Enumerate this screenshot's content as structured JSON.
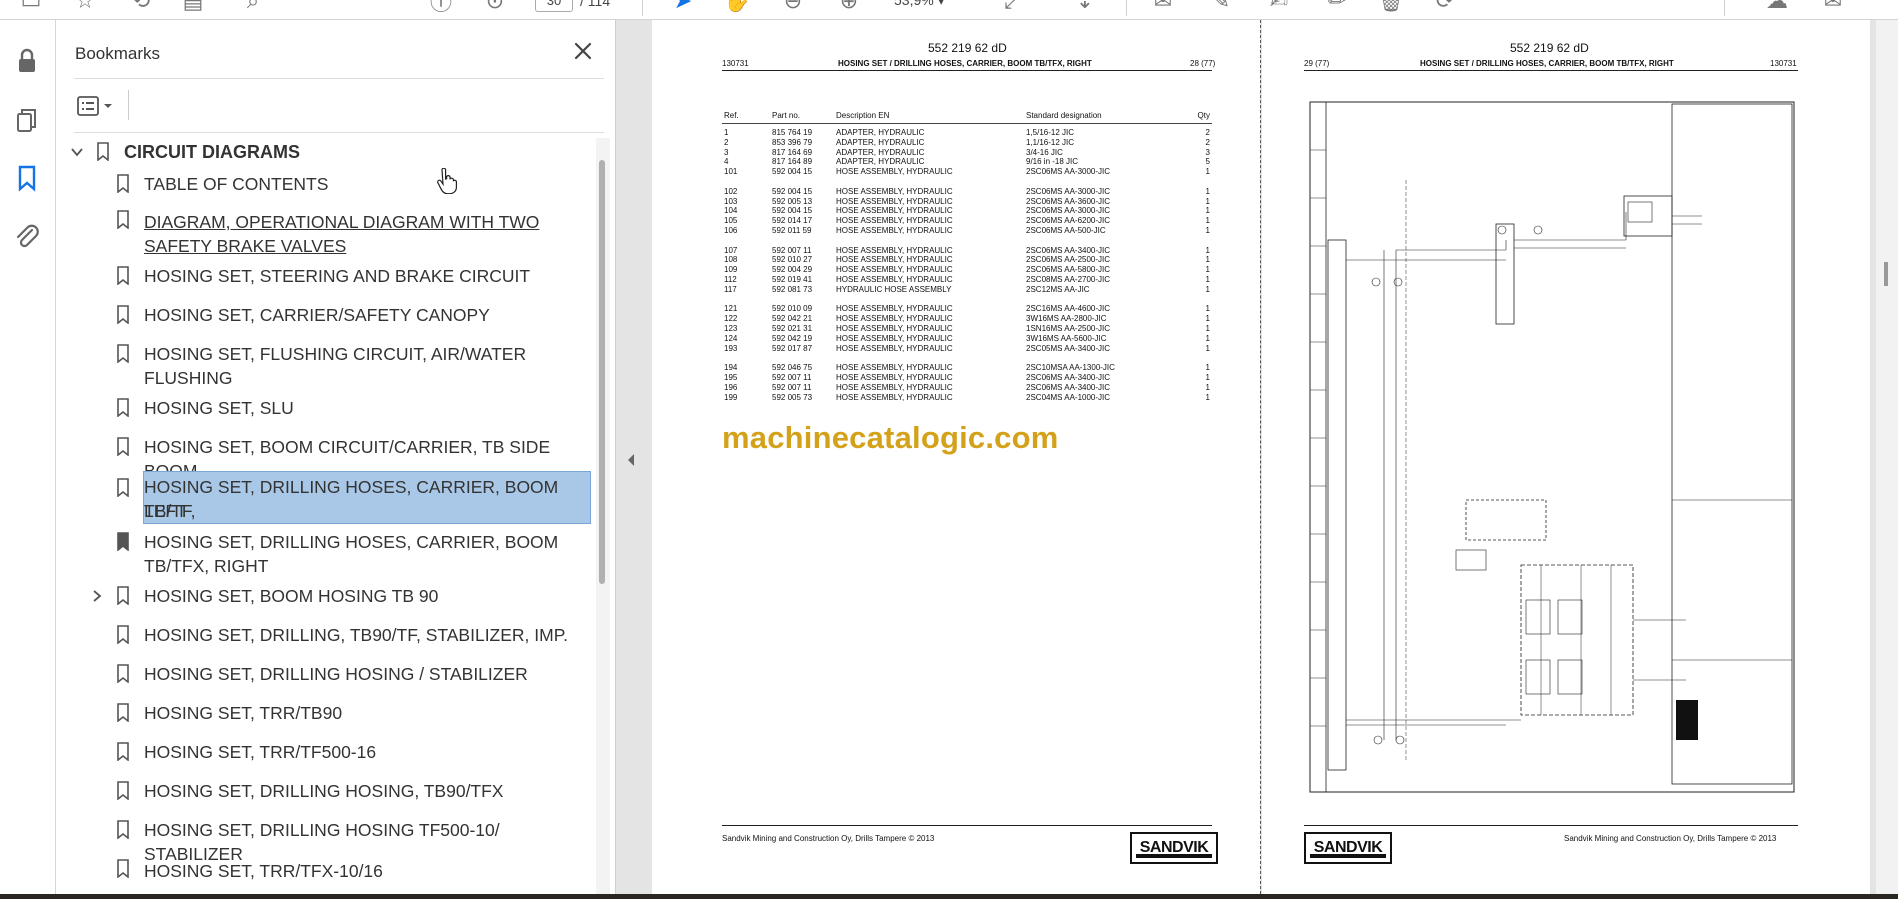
{
  "toolbar": {
    "page_current": "30",
    "page_total": "/ 114",
    "zoom": "53,9%"
  },
  "bookmarks": {
    "title": "Bookmarks",
    "root_label": "CIRCUIT DIAGRAMS",
    "items": [
      {
        "label": "TABLE OF CONTENTS"
      },
      {
        "label": "DIAGRAM, OPERATIONAL DIAGRAM WITH TWO"
      },
      {
        "label": "SAFETY BRAKE VALVES"
      },
      {
        "label": "HOSING SET, STEERING AND BRAKE CIRCUIT"
      },
      {
        "label": "HOSING SET, CARRIER/SAFETY CANOPY"
      },
      {
        "label": "HOSING SET, FLUSHING CIRCUIT, AIR/WATER"
      },
      {
        "label": "FLUSHING"
      },
      {
        "label": "HOSING SET, SLU"
      },
      {
        "label": "HOSING SET, BOOM CIRCUIT/CARRIER, TB SIDE BOOM"
      },
      {
        "label": "HOSING SET, DRILLING HOSES, CARRIER, BOOM TB/TF,"
      },
      {
        "label": "LEFT"
      },
      {
        "label": "HOSING SET, DRILLING HOSES, CARRIER,  BOOM"
      },
      {
        "label": "TB/TFX, RIGHT"
      },
      {
        "label": "HOSING SET, BOOM HOSING TB 90"
      },
      {
        "label": "HOSING SET, DRILLING, TB90/TF, STABILIZER, IMP."
      },
      {
        "label": "HOSING SET, DRILLING HOSING / STABILIZER"
      },
      {
        "label": "HOSING SET, TRR/TB90"
      },
      {
        "label": "HOSING SET, TRR/TF500-16"
      },
      {
        "label": "HOSING SET, DRILLING HOSING, TB90/TFX"
      },
      {
        "label": "HOSING SET, DRILLING HOSING TF500-10/ STABILIZER"
      },
      {
        "label": "HOSING SET, TRR/TFX-10/16"
      }
    ]
  },
  "page_left": {
    "doc_number": "552 219 62 dD",
    "code": "130731",
    "title": "HOSING SET / DRILLING HOSES, CARRIER, BOOM TB/TFX, RIGHT",
    "page_label": "28 (77)",
    "columns": {
      "ref": "Ref.",
      "part": "Part no.",
      "desc": "Description EN",
      "std": "Standard designation",
      "qty": "Qty"
    },
    "rows": [
      {
        "ref": "1",
        "part": "815 764 19",
        "desc": "ADAPTER, HYDRAULIC",
        "std": "1,5/16-12 JIC",
        "qty": "2"
      },
      {
        "ref": "2",
        "part": "853 396 79",
        "desc": "ADAPTER, HYDRAULIC",
        "std": "1,1/16-12 JIC",
        "qty": "2"
      },
      {
        "ref": "3",
        "part": "817 164 69",
        "desc": "ADAPTER, HYDRAULIC",
        "std": "3/4-16 JIC",
        "qty": "3"
      },
      {
        "ref": "4",
        "part": "817 164 89",
        "desc": "ADAPTER, HYDRAULIC",
        "std": "9/16 in -18 JIC",
        "qty": "5"
      },
      {
        "ref": "101",
        "part": "592 004 15",
        "desc": "HOSE ASSEMBLY, HYDRAULIC",
        "std": "2SC06MS AA-3000-JIC",
        "qty": "1"
      },
      {
        "ref": "102",
        "part": "592 004 15",
        "desc": "HOSE ASSEMBLY, HYDRAULIC",
        "std": "2SC06MS AA-3000-JIC",
        "qty": "1"
      },
      {
        "ref": "103",
        "part": "592 005 13",
        "desc": "HOSE ASSEMBLY, HYDRAULIC",
        "std": "2SC06MS AA-3600-JIC",
        "qty": "1"
      },
      {
        "ref": "104",
        "part": "592 004 15",
        "desc": "HOSE ASSEMBLY, HYDRAULIC",
        "std": "2SC06MS AA-3000-JIC",
        "qty": "1"
      },
      {
        "ref": "105",
        "part": "592 014 17",
        "desc": "HOSE ASSEMBLY, HYDRAULIC",
        "std": "2SC06MS AA-6200-JIC",
        "qty": "1"
      },
      {
        "ref": "106",
        "part": "592 011 59",
        "desc": "HOSE ASSEMBLY, HYDRAULIC",
        "std": "2SC06MS AA-500-JIC",
        "qty": "1"
      },
      {
        "ref": "107",
        "part": "592 007 11",
        "desc": "HOSE ASSEMBLY, HYDRAULIC",
        "std": "2SC06MS AA-3400-JIC",
        "qty": "1"
      },
      {
        "ref": "108",
        "part": "592 010 27",
        "desc": "HOSE ASSEMBLY, HYDRAULIC",
        "std": "2SC06MS AA-2500-JIC",
        "qty": "1"
      },
      {
        "ref": "109",
        "part": "592 004 29",
        "desc": "HOSE ASSEMBLY, HYDRAULIC",
        "std": "2SC06MS AA-5800-JIC",
        "qty": "1"
      },
      {
        "ref": "112",
        "part": "592 019 41",
        "desc": "HOSE ASSEMBLY, HYDRAULIC",
        "std": "2SC08MS AA-2700-JIC",
        "qty": "1"
      },
      {
        "ref": "117",
        "part": "592 081 73",
        "desc": "HYDRAULIC HOSE ASSEMBLY",
        "std": "2SC12MS AA-JIC",
        "qty": "1"
      },
      {
        "ref": "121",
        "part": "592 010 09",
        "desc": "HOSE ASSEMBLY, HYDRAULIC",
        "std": "2SC16MS AA-4600-JIC",
        "qty": "1"
      },
      {
        "ref": "122",
        "part": "592 042 21",
        "desc": "HOSE ASSEMBLY, HYDRAULIC",
        "std": "3W16MS AA-2800-JIC",
        "qty": "1"
      },
      {
        "ref": "123",
        "part": "592 021 31",
        "desc": "HOSE ASSEMBLY, HYDRAULIC",
        "std": "1SN16MS AA-2500-JIC",
        "qty": "1"
      },
      {
        "ref": "124",
        "part": "592 042 19",
        "desc": "HOSE ASSEMBLY, HYDRAULIC",
        "std": "3W16MS AA-5600-JIC",
        "qty": "1"
      },
      {
        "ref": "193",
        "part": "592 017 87",
        "desc": "HOSE ASSEMBLY, HYDRAULIC",
        "std": "2SC05MS AA-3400-JIC",
        "qty": "1"
      },
      {
        "ref": "194",
        "part": "592 046 75",
        "desc": "HOSE ASSEMBLY, HYDRAULIC",
        "std": "2SC10MSA AA-1300-JIC",
        "qty": "1"
      },
      {
        "ref": "195",
        "part": "592 007 11",
        "desc": "HOSE ASSEMBLY, HYDRAULIC",
        "std": "2SC06MS AA-3400-JIC",
        "qty": "1"
      },
      {
        "ref": "196",
        "part": "592 007 11",
        "desc": "HOSE ASSEMBLY, HYDRAULIC",
        "std": "2SC06MS AA-3400-JIC",
        "qty": "1"
      },
      {
        "ref": "199",
        "part": "592 005 73",
        "desc": "HOSE ASSEMBLY, HYDRAULIC",
        "std": "2SC04MS AA-1000-JIC",
        "qty": "1"
      }
    ],
    "watermark": "machinecatalogic.com",
    "footer": "Sandvik Mining and Construction Oy, Drills Tampere © 2013",
    "logo": "SANDVIK"
  },
  "page_right": {
    "doc_number": "552 219 62 dD",
    "page_label": "29 (77)",
    "title": "HOSING SET / DRILLING HOSES, CARRIER, BOOM TB/TFX, RIGHT",
    "code": "130731",
    "footer": "Sandvik Mining and Construction Oy, Drills Tampere © 2013",
    "logo": "SANDVIK"
  }
}
